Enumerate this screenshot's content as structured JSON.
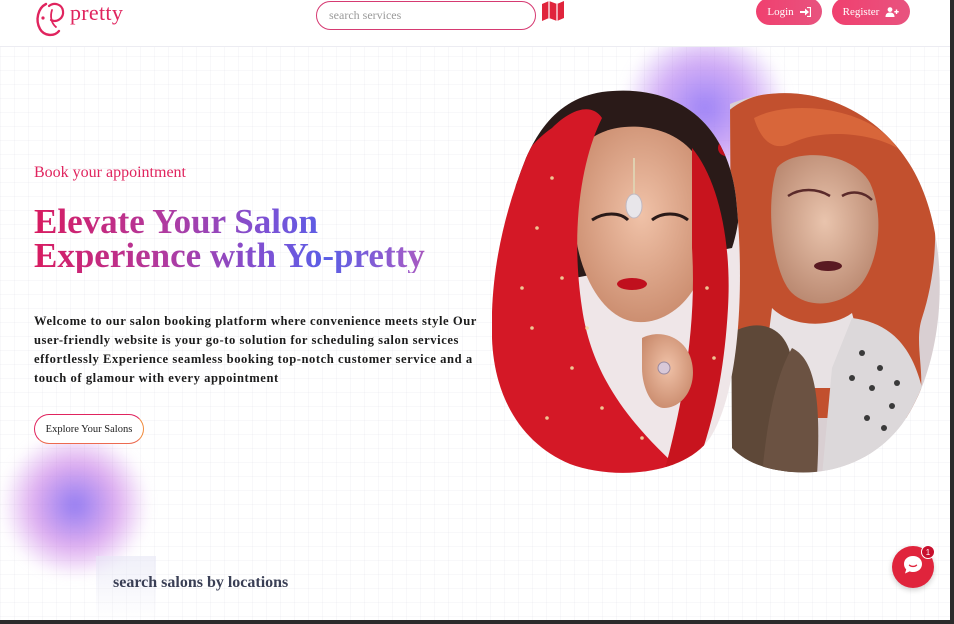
{
  "brand": {
    "logo_text": "pretty",
    "accent_color": "#e0245e"
  },
  "navbar": {
    "search": {
      "placeholder": "search services",
      "value": ""
    },
    "map_icon": "map-icon",
    "login_label": "Login",
    "login_icon": "sign-in-icon",
    "register_label": "Register",
    "register_icon": "user-plus-icon"
  },
  "hero": {
    "eyebrow": "Book your appointment",
    "title_line1": "Elevate Your Salon",
    "title_line2": "Experience with Yo-pretty",
    "description": "Welcome to our salon booking platform where convenience meets style Our user-friendly website is your go-to solution for scheduling salon services effortlessly Experience seamless booking top-notch customer service and a touch of glamour with every appointment",
    "cta_label": "Explore Your Salons"
  },
  "locations_section": {
    "title": "search salons by locations"
  },
  "chat": {
    "icon": "chat-bubble-icon",
    "badge_count": "1",
    "color": "#e0243c"
  }
}
